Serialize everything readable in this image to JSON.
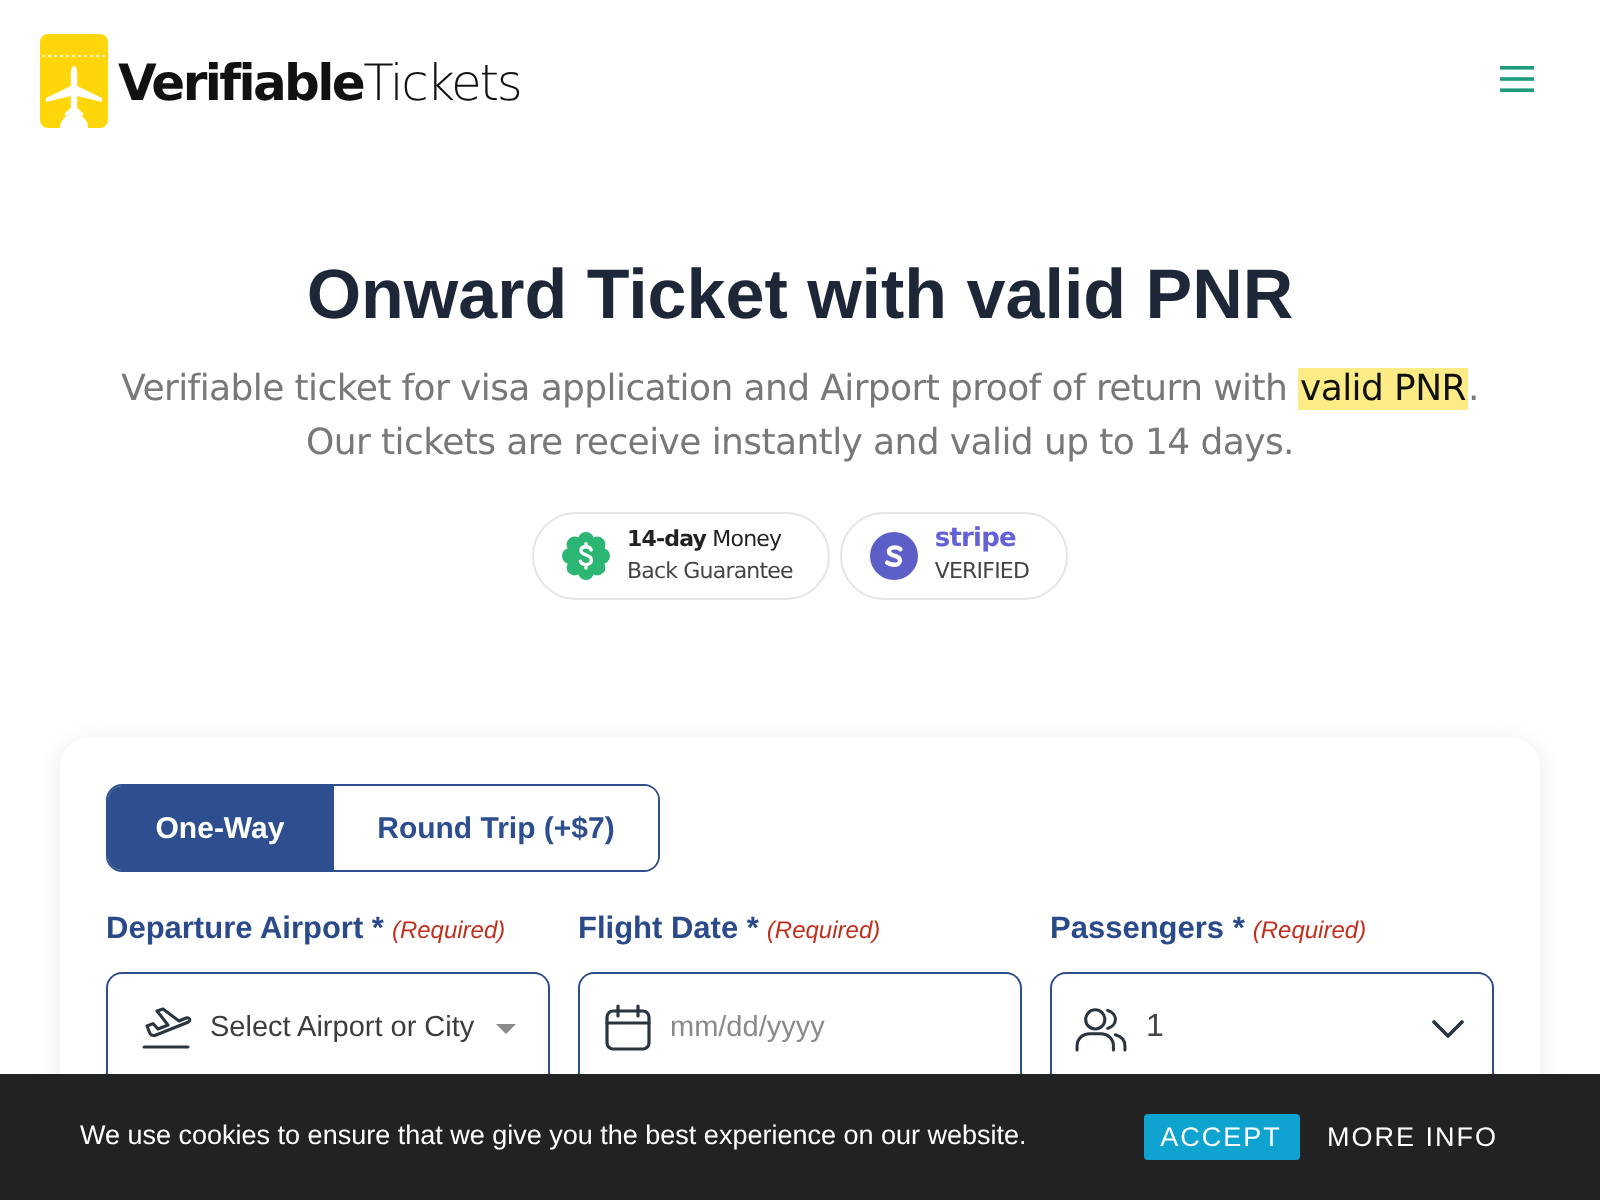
{
  "header": {
    "logo": "**Verifiable**Tickets"
  },
  "hero": {
    "title": "Onward Ticket with valid PNR",
    "subtitle_line_1": {
      "text": "Verifiable ticket for visa application and Airport proof of return with ",
      "highlight": "valid PNR",
      "end": "."
    },
    "subtitle_line_2": "Our tickets are receive instantly and valid up to 14 days."
  },
  "badges": [
    {
      "kind": "guarantee",
      "line_1": "**14-day** Money",
      "line_2": "Back Guarantee"
    },
    {
      "kind": "stripe",
      "line_1": "stripe",
      "line_2": "VERIFIED"
    }
  ],
  "trip_type_tabs": [
    {
      "label": "One-Way",
      "selected": true
    },
    {
      "label": "Round Trip (+$7)",
      "selected": false
    }
  ],
  "fields": [
    {
      "kind": "airport",
      "label": "Departure Airport *",
      "required_note": "(Required)",
      "placeholder": "Select Airport or City"
    },
    {
      "kind": "date",
      "label": "Flight Date *",
      "required_note": "(Required)",
      "placeholder": "mm/dd/yyyy"
    },
    {
      "kind": "passengers",
      "label": "Passengers *",
      "required_note": "(Required)",
      "value": "1"
    }
  ],
  "cookie_bar": {
    "message": "We use cookies to ensure that we give you the best experience on our website.",
    "buttons": [
      {
        "kind": "accept",
        "label": "ACCEPT"
      },
      {
        "kind": "more_info",
        "label": "MORE INFO"
      }
    ]
  }
}
